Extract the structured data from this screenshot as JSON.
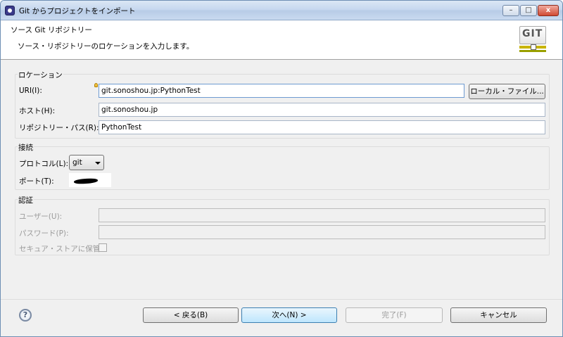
{
  "window": {
    "title": "Git からプロジェクトをインポート"
  },
  "window_controls": {
    "minimize": "–",
    "maximize": "□",
    "close": "x"
  },
  "header": {
    "title": "ソース Git リポジトリー",
    "description": "ソース・リポジトリーのロケーションを入力します。",
    "logo_text": "GIT"
  },
  "location": {
    "group_label": "ロケーション",
    "uri_label": "URI(I):",
    "uri_value": "git.sonoshou.jp:PythonTest",
    "local_file_button": "ローカル・ファイル...",
    "host_label": "ホスト(H):",
    "host_value": "git.sonoshou.jp",
    "repo_path_label": "リポジトリー・パス(R):",
    "repo_path_value": "PythonTest"
  },
  "connection": {
    "group_label": "接続",
    "protocol_label": "プロトコル(L):",
    "protocol_value": "git",
    "port_label": "ポート(T):",
    "port_value": ""
  },
  "auth": {
    "group_label": "認証",
    "user_label": "ユーザー(U):",
    "user_value": "",
    "password_label": "パスワード(P):",
    "password_value": "",
    "secure_store_label": "セキュア・ストアに保管"
  },
  "footer": {
    "help_icon_glyph": "?",
    "back_button": "< 戻る(B)",
    "next_button": "次へ(N) >",
    "finish_button": "完了(F)",
    "cancel_button": "キャンセル"
  },
  "icons": [
    "app-icon",
    "git-logo-icon",
    "lightbulb-icon",
    "help-icon",
    "chevron-down-icon"
  ]
}
